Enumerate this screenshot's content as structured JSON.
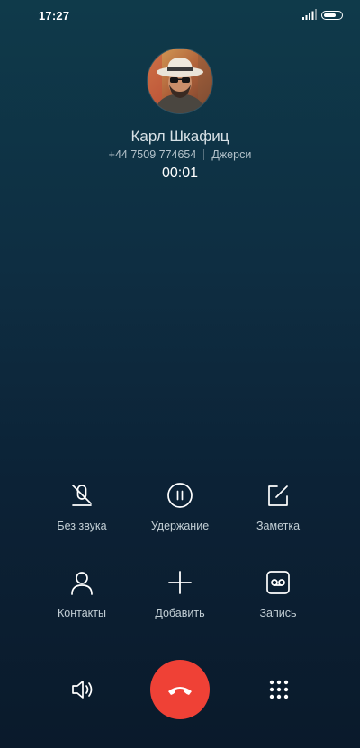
{
  "status_bar": {
    "time": "17:27",
    "icons": [
      "signal-icon",
      "battery-icon"
    ]
  },
  "contact": {
    "name": "Карл Шкафиц",
    "number": "+44 7509 774654",
    "location": "Джерси",
    "duration": "00:01"
  },
  "controls": {
    "mute": {
      "label": "Без звука",
      "icon": "mic-off-icon"
    },
    "hold": {
      "label": "Удержание",
      "icon": "pause-icon"
    },
    "note": {
      "label": "Заметка",
      "icon": "note-edit-icon"
    },
    "contacts": {
      "label": "Контакты",
      "icon": "person-icon"
    },
    "add": {
      "label": "Добавить",
      "icon": "plus-icon"
    },
    "record": {
      "label": "Запись",
      "icon": "record-icon"
    }
  },
  "bottom_bar": {
    "speaker_icon": "speaker-icon",
    "end_call_icon": "end-call-icon",
    "end_call_color": "#ef4136",
    "keypad_icon": "keypad-icon"
  }
}
